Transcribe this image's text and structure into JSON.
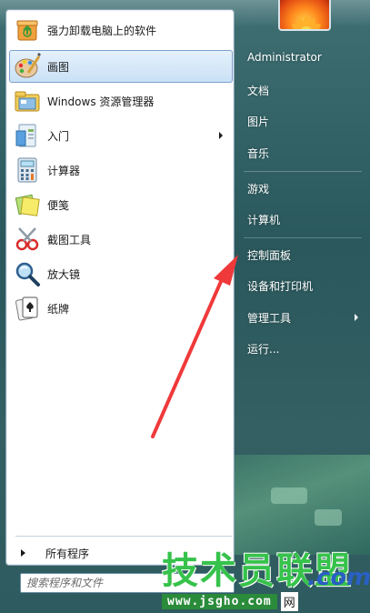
{
  "programs": [
    {
      "label": "强力卸载电脑上的软件",
      "icon": "recycle-box-icon"
    },
    {
      "label": "画图",
      "icon": "paint-palette-icon",
      "selected": true
    },
    {
      "label": "Windows 资源管理器",
      "icon": "folder-explorer-icon"
    },
    {
      "label": "入门",
      "icon": "getting-started-icon",
      "has_submenu": true
    },
    {
      "label": "计算器",
      "icon": "calculator-icon"
    },
    {
      "label": "便笺",
      "icon": "sticky-notes-icon"
    },
    {
      "label": "截图工具",
      "icon": "snipping-tool-icon"
    },
    {
      "label": "放大镜",
      "icon": "magnifier-icon"
    },
    {
      "label": "纸牌",
      "icon": "solitaire-cards-icon"
    }
  ],
  "all_programs_label": "所有程序",
  "search": {
    "placeholder": "搜索程序和文件"
  },
  "right_menu": [
    {
      "label": "Administrator"
    },
    {
      "label": "文档"
    },
    {
      "label": "图片"
    },
    {
      "label": "音乐"
    },
    {
      "label": "游戏"
    },
    {
      "label": "计算机"
    },
    {
      "label": "控制面板"
    },
    {
      "label": "设备和打印机"
    },
    {
      "label": "管理工具",
      "has_submenu": true
    },
    {
      "label": "运行..."
    }
  ],
  "watermark": {
    "logo": "技术员联盟",
    "com": ".com",
    "url": "www.jsgho.com",
    "net": "网"
  },
  "colors": {
    "selection": "#c9e1f6",
    "arrow": "#f0393a",
    "watermark_green": "#36c24b"
  }
}
